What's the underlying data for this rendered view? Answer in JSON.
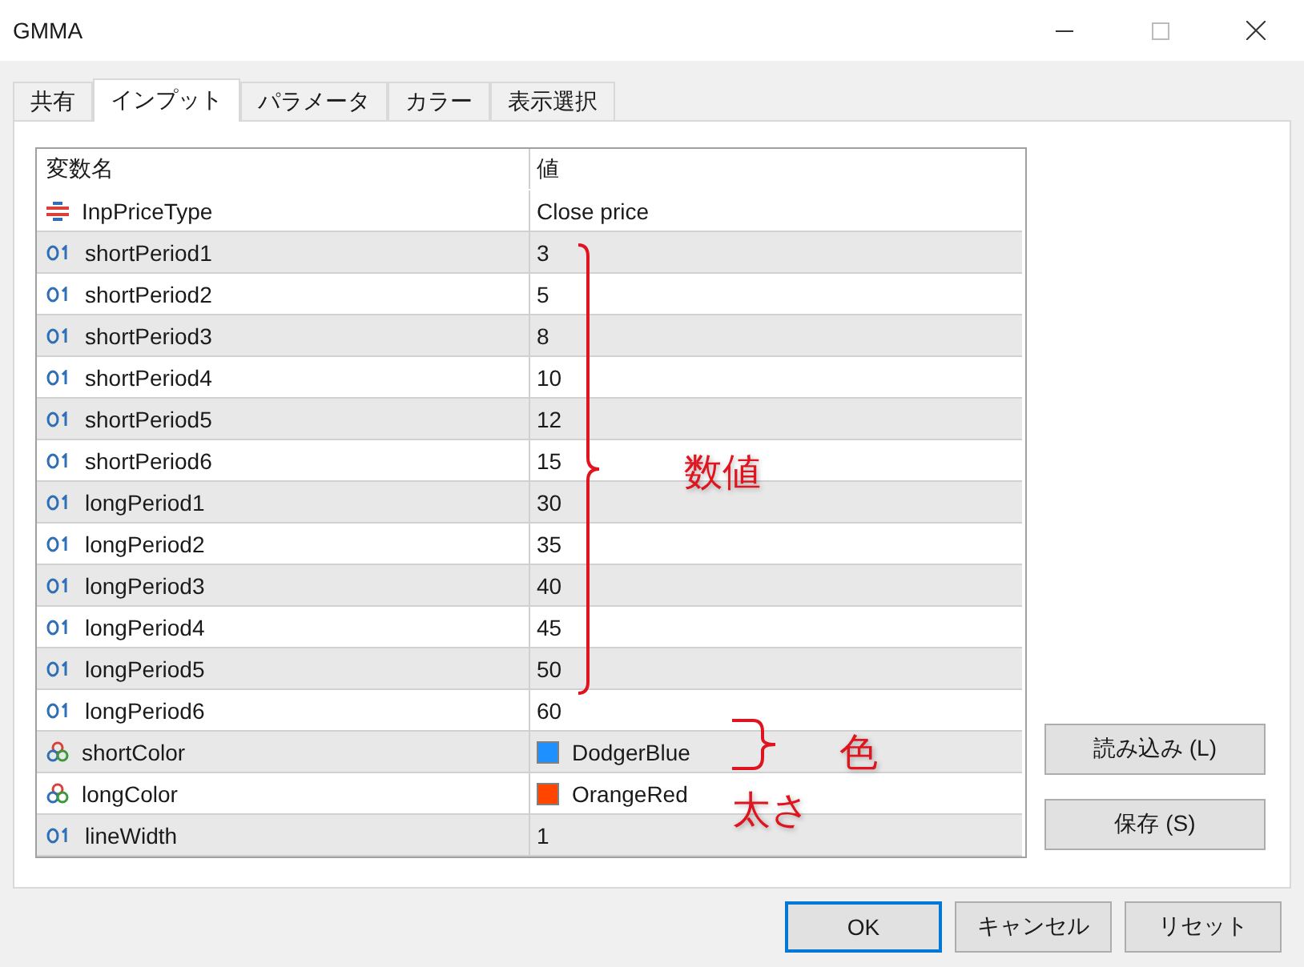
{
  "window": {
    "title": "GMMA"
  },
  "tabs": [
    {
      "label": "共有",
      "selected": false
    },
    {
      "label": "インプット",
      "selected": true
    },
    {
      "label": "パラメータ",
      "selected": false
    },
    {
      "label": "カラー",
      "selected": false
    },
    {
      "label": "表示選択",
      "selected": false
    }
  ],
  "table": {
    "columns": [
      "変数名",
      "値"
    ],
    "rows": [
      {
        "kind": "enum",
        "name": "InpPriceType",
        "value": "Close price"
      },
      {
        "kind": "int",
        "name": "shortPeriod1",
        "value": "3"
      },
      {
        "kind": "int",
        "name": "shortPeriod2",
        "value": "5"
      },
      {
        "kind": "int",
        "name": "shortPeriod3",
        "value": "8"
      },
      {
        "kind": "int",
        "name": "shortPeriod4",
        "value": "10"
      },
      {
        "kind": "int",
        "name": "shortPeriod5",
        "value": "12"
      },
      {
        "kind": "int",
        "name": "shortPeriod6",
        "value": "15"
      },
      {
        "kind": "int",
        "name": "longPeriod1",
        "value": "30"
      },
      {
        "kind": "int",
        "name": "longPeriod2",
        "value": "35"
      },
      {
        "kind": "int",
        "name": "longPeriod3",
        "value": "40"
      },
      {
        "kind": "int",
        "name": "longPeriod4",
        "value": "45"
      },
      {
        "kind": "int",
        "name": "longPeriod5",
        "value": "50"
      },
      {
        "kind": "int",
        "name": "longPeriod6",
        "value": "60"
      },
      {
        "kind": "color",
        "name": "shortColor",
        "value": "DodgerBlue",
        "color": "#1e90ff"
      },
      {
        "kind": "color",
        "name": "longColor",
        "value": "OrangeRed",
        "color": "#ff4500"
      },
      {
        "kind": "int",
        "name": "lineWidth",
        "value": "1"
      }
    ]
  },
  "side_buttons": [
    "読み込み (L)",
    "保存 (S)"
  ],
  "annotations": [
    {
      "label": "数値"
    },
    {
      "label": "色"
    },
    {
      "label": "太さ"
    }
  ],
  "buttons": [
    {
      "label": "OK",
      "default": true
    },
    {
      "label": "キャンセル",
      "default": false
    },
    {
      "label": "リセット",
      "default": false
    }
  ]
}
